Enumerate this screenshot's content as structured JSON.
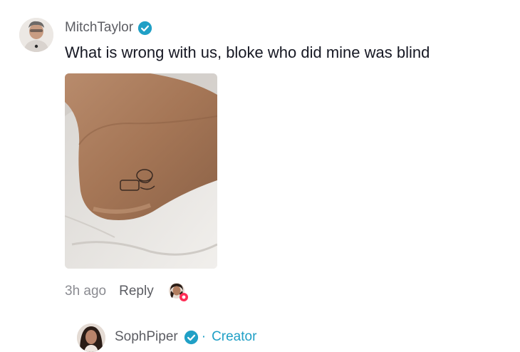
{
  "comment": {
    "username": "MitchTaylor",
    "text": "What is wrong with us, bloke who did mine was blind",
    "time": "3h ago",
    "reply_label": "Reply"
  },
  "reply": {
    "username": "SophPiper",
    "separator": "·",
    "creator_label": "Creator"
  },
  "colors": {
    "verified": "#20a0c6",
    "creator": "#20a0c6",
    "muted_text": "#8a8b91",
    "liked_badge": "#fe2c55"
  },
  "icons": {
    "verified": "verified-check-icon",
    "liked_badge": "heart-badge-icon"
  }
}
